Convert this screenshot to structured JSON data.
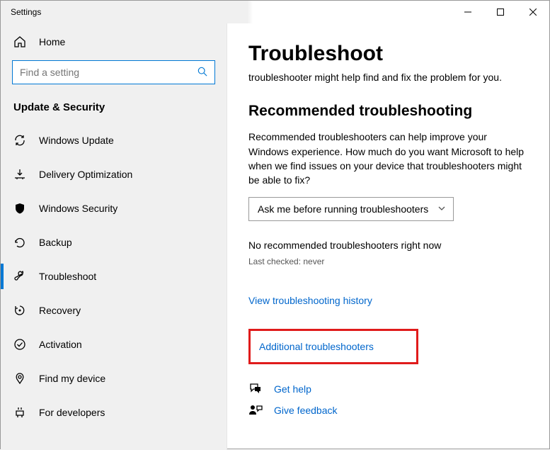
{
  "titlebar": {
    "title": "Settings"
  },
  "sidebar": {
    "home": "Home",
    "search_placeholder": "Find a setting",
    "category": "Update & Security",
    "items": [
      {
        "label": "Windows Update"
      },
      {
        "label": "Delivery Optimization"
      },
      {
        "label": "Windows Security"
      },
      {
        "label": "Backup"
      },
      {
        "label": "Troubleshoot"
      },
      {
        "label": "Recovery"
      },
      {
        "label": "Activation"
      },
      {
        "label": "Find my device"
      },
      {
        "label": "For developers"
      }
    ]
  },
  "content": {
    "title": "Troubleshoot",
    "intro": "troubleshooter might help find and fix the problem for you.",
    "rec_heading": "Recommended troubleshooting",
    "rec_text": "Recommended troubleshooters can help improve your Windows experience. How much do you want Microsoft to help when we find issues on your device that troubleshooters might be able to fix?",
    "dropdown_value": "Ask me before running troubleshooters",
    "status": "No recommended troubleshooters right now",
    "last_checked": "Last checked: never",
    "history_link": "View troubleshooting history",
    "additional_link": "Additional troubleshooters",
    "help": "Get help",
    "feedback": "Give feedback"
  }
}
